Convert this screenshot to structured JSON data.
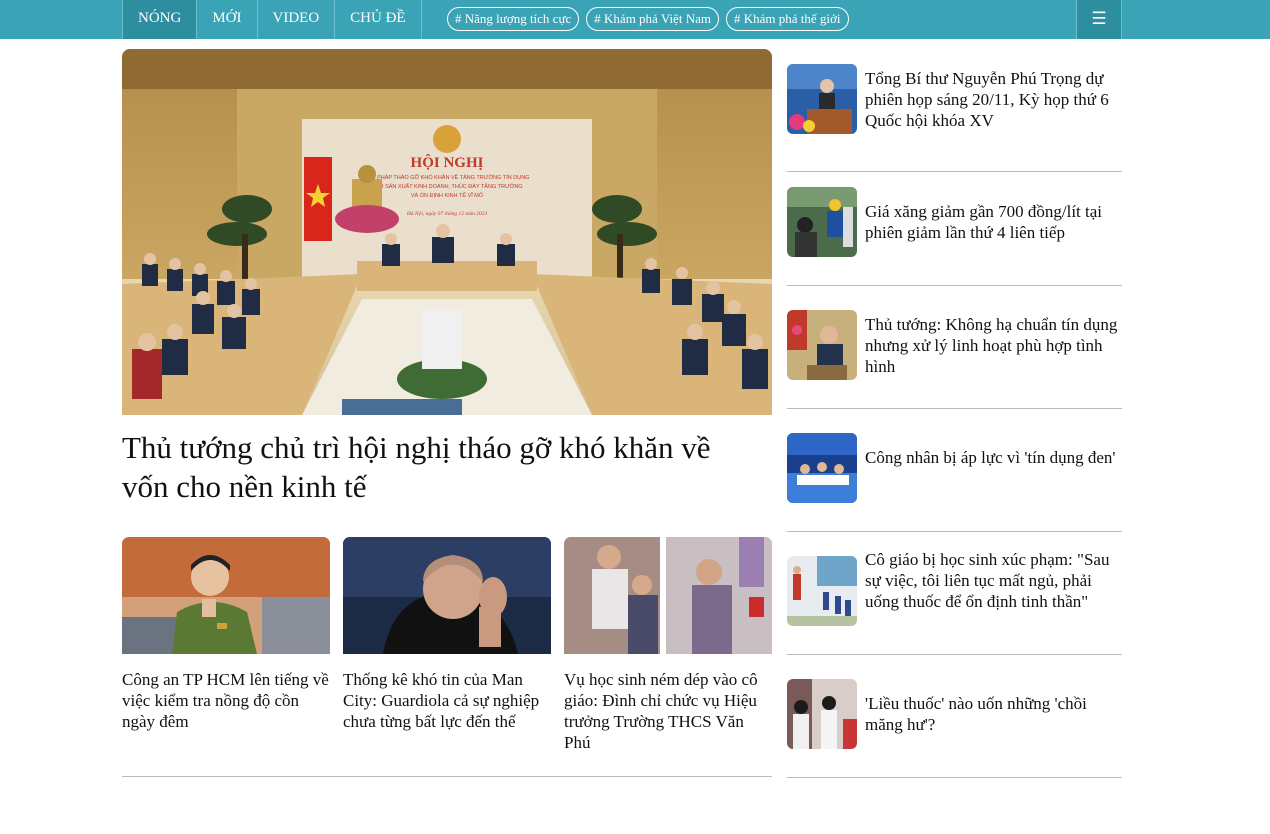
{
  "nav": {
    "items": [
      "NÓNG",
      "MỚI",
      "VIDEO",
      "CHỦ ĐỀ"
    ],
    "tags": [
      "# Năng lượng tích cực",
      "# Khám phá Việt Nam",
      "# Khám phá thế giới"
    ],
    "menu_icon": "☰"
  },
  "hero": {
    "title": "Thủ tướng chủ trì hội nghị tháo gỡ khó khăn về vốn cho nền kinh tế",
    "image_text": {
      "heading": "HỘI NGHỊ",
      "line1": "GIẢI PHÁP THÁO GỠ KHÓ KHĂN VỀ TĂNG TRƯỞNG TÍN DỤNG",
      "line2": "CHO SẢN XUẤT KINH DOANH, THÚC ĐẨY TĂNG TRƯỞNG",
      "line3": "VÀ ỔN ĐỊNH KINH TẾ VĨ MÔ",
      "date": "Hà Nội, ngày 07 tháng 12 năm 2023"
    }
  },
  "cards": [
    {
      "title": "Công an TP HCM lên tiếng về việc kiểm tra nồng độ cồn ngày đêm"
    },
    {
      "title": "Thống kê khó tin của Man City: Guardiola cả sự nghiệp chưa từng bất lực đến thế"
    },
    {
      "title": "Vụ học sinh ném dép vào cô giáo: Đình chỉ chức vụ Hiệu trưởng Trường THCS Văn Phú"
    }
  ],
  "side": [
    {
      "title": "Tổng Bí thư Nguyễn Phú Trọng dự phiên họp sáng 20/11, Kỳ họp thứ 6 Quốc hội khóa XV"
    },
    {
      "title": "Giá xăng giảm gần 700 đồng/lít tại phiên giảm lần thứ 4 liên tiếp"
    },
    {
      "title": "Thủ tướng: Không hạ chuẩn tín dụng nhưng xử lý linh hoạt phù hợp tình hình"
    },
    {
      "title": "Công nhân bị áp lực vì 'tín dụng đen'"
    },
    {
      "title": "Cô giáo bị học sinh xúc phạm: \"Sau sự việc, tôi liên tục mất ngủ, phải uống thuốc để ổn định tinh thần\""
    },
    {
      "title": "'Liều thuốc' nào uốn những 'chồi măng hư'?"
    }
  ]
}
